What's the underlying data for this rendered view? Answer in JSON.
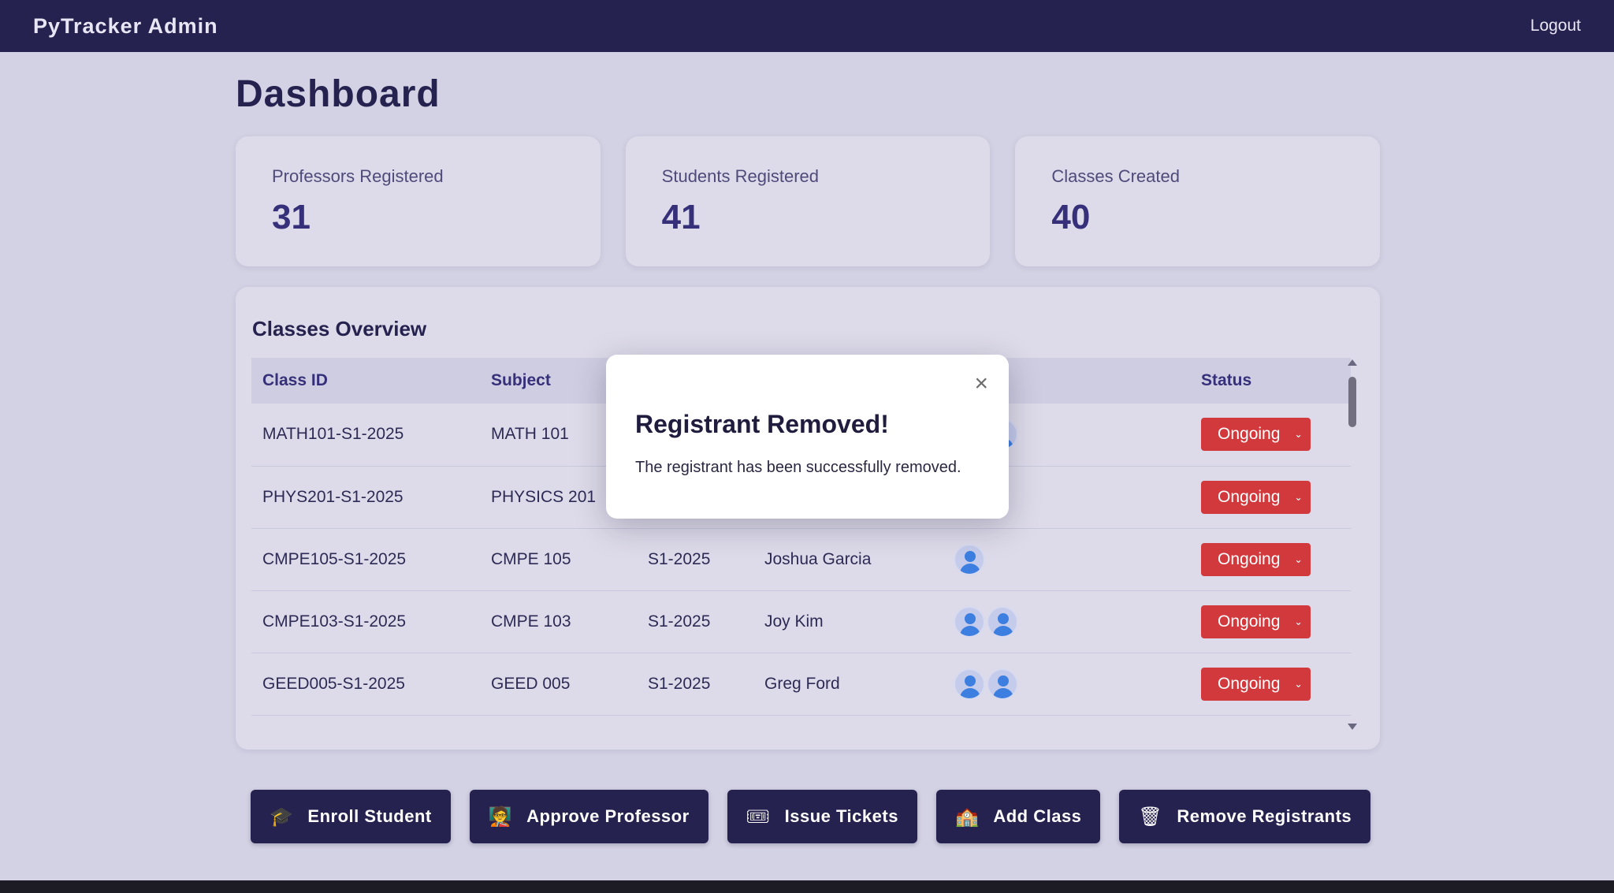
{
  "app": {
    "brand": "PyTracker Admin",
    "logout": "Logout"
  },
  "page": {
    "title": "Dashboard"
  },
  "stats": [
    {
      "label": "Professors Registered",
      "value": "31"
    },
    {
      "label": "Students Registered",
      "value": "41"
    },
    {
      "label": "Classes Created",
      "value": "40"
    }
  ],
  "overview": {
    "title": "Classes Overview",
    "headers": [
      "Class ID",
      "Subject",
      "",
      "",
      "ts",
      "Status"
    ],
    "rows": [
      {
        "class_id": "MATH101-S1-2025",
        "subject": "MATH 101",
        "semester": "",
        "professor": "",
        "students": 2,
        "status": "Ongoing"
      },
      {
        "class_id": "PHYS201-S1-2025",
        "subject": "PHYSICS 201",
        "semester": "",
        "professor": "",
        "students": 1,
        "status": "Ongoing"
      },
      {
        "class_id": "CMPE105-S1-2025",
        "subject": "CMPE 105",
        "semester": "S1-2025",
        "professor": "Joshua Garcia",
        "students": 1,
        "status": "Ongoing"
      },
      {
        "class_id": "CMPE103-S1-2025",
        "subject": "CMPE 103",
        "semester": "S1-2025",
        "professor": "Joy Kim",
        "students": 2,
        "status": "Ongoing"
      },
      {
        "class_id": "GEED005-S1-2025",
        "subject": "GEED 005",
        "semester": "S1-2025",
        "professor": "Greg Ford",
        "students": 2,
        "status": "Ongoing"
      }
    ]
  },
  "actions": [
    {
      "label": "Enroll Student",
      "icon": "🎓",
      "name": "enroll-student-button"
    },
    {
      "label": "Approve Professor",
      "icon": "🧑‍🏫",
      "name": "approve-professor-button"
    },
    {
      "label": "Issue Tickets",
      "icon": "🎟",
      "name": "issue-tickets-button"
    },
    {
      "label": "Add Class",
      "icon": "🏫",
      "name": "add-class-button"
    },
    {
      "label": "Remove Registrants",
      "icon": "🗑",
      "name": "remove-registrants-button"
    }
  ],
  "modal": {
    "title": "Registrant Removed!",
    "message": "The registrant has been successfully removed.",
    "close": "×"
  },
  "colors": {
    "nav": "#26224f",
    "status_ongoing": "#d2393d",
    "background": "#d3d2e4"
  }
}
